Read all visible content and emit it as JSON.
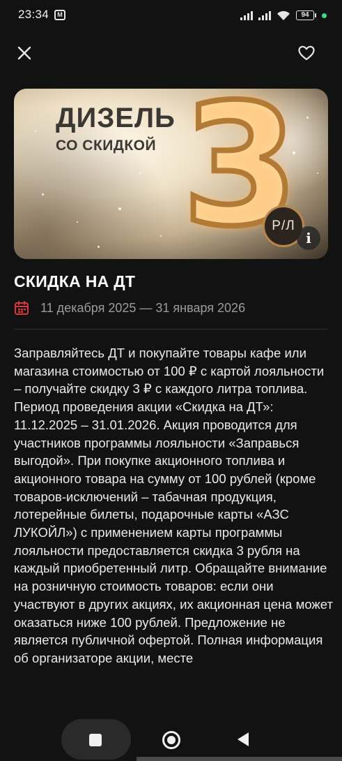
{
  "status_bar": {
    "time": "23:34",
    "app_icon": "M",
    "battery": "94",
    "icons": [
      "signal-icon",
      "signal-icon",
      "wifi-icon",
      "battery-icon",
      "green-dot-indicator"
    ]
  },
  "header": {
    "close_icon": "close-icon",
    "favorite_icon": "heart-icon"
  },
  "banner": {
    "title": "ДИЗЕЛЬ",
    "subtitle": "СО СКИДКОЙ",
    "number": "3",
    "badge": "Р/Л",
    "info": "i"
  },
  "promo": {
    "title": "СКИДКА НА ДТ",
    "dates": "11 декабря 2025 — 31 января 2026",
    "paragraph_1": "Заправляйтесь ДТ и покупайте товары кафе или магазина стоимостью от 100 ₽ с картой лояльности – получайте скидку 3 ₽ с каждого литра топлива.",
    "paragraph_2": "Период проведения акции «Скидка на ДТ»: 11.12.2025 – 31.01.2026. Акция проводится для участников программы лояльности «Заправься выгодой». При покупке акционного топлива и акционного товара на сумму от 100 рублей (кроме товаров-исключений – табачная продукция, лотерейные билеты, подарочные карты «АЗС ЛУКОЙЛ») с применением карты программы лояльности предоставляется скидка 3 рубля на каждый приобретенный литр. Обращайте внимание на розничную стоимость товаров: если они участвуют в других акциях, их акционная цена может оказаться ниже 100 рублей. Предложение не является публичной офертой. Полная информация об организаторе акции, месте"
  },
  "colors": {
    "background": "#121212",
    "calendar_accent": "#e0343d",
    "date_text": "#9c9c9c",
    "banner_gold": "#b27a34"
  },
  "nav": {
    "recents_icon": "square-icon",
    "home_icon": "circle-icon",
    "back_icon": "back-triangle-icon"
  }
}
